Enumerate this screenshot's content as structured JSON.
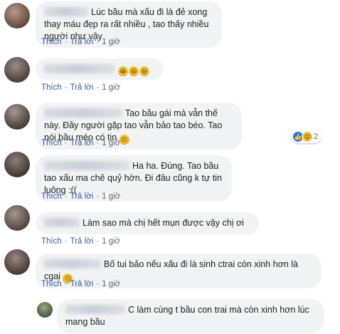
{
  "labels": {
    "like": "Thích",
    "reply": "Trả lời"
  },
  "comments": [
    {
      "text": "Lúc bầu mà xấu đi là đẻ xong thay máu đẹp ra rất nhiều , tao thấy nhiều người như vậy",
      "time": "1 giờ"
    },
    {
      "text": "",
      "emojis": [
        "😭",
        "😆",
        "😆"
      ],
      "time": "1 giờ"
    },
    {
      "text": "Tao bầu gái mà vẫn thế này. Đầy người gặp tao vẫn bảo tao béo. Tao nói bầu méo có tin",
      "emoji": "😔",
      "reaction_count": "2",
      "time": "1 giờ"
    },
    {
      "text": "Ha ha. Đúng. Tao bầu tao xấu ma chê quỷ hờn. Đi đâu cũng k tự tin luông :((",
      "time": "1 giờ"
    },
    {
      "text": "Làm sao mà chị hết mụn được vậy chị ơi",
      "time": "1 giờ"
    },
    {
      "text": "Bố tui bảo nếu xấu đi là sinh ctrai còn xinh hơn là cgai",
      "emoji": "😕",
      "time": "1 giờ"
    },
    {
      "text": "C làm cùng t bầu con trai mà còn xinh hơn lúc mang bầu"
    }
  ],
  "colors": {
    "bubble": "#f2f3f5",
    "link": "#385898",
    "meta": "#606770"
  }
}
